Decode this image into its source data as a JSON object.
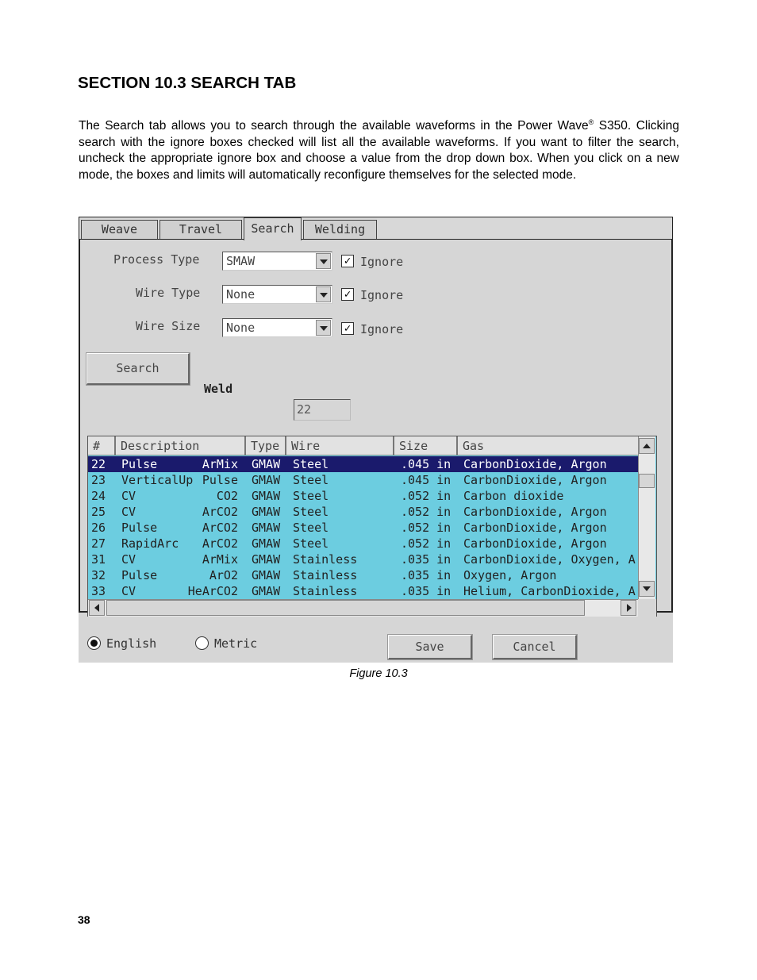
{
  "heading": "SECTION 10.3 SEARCH TAB",
  "paragraph": {
    "part1": "The Search tab allows you to search through the available waveforms in the Power Wave",
    "reg": "®",
    "part2": " S350. Clicking search with the ignore boxes checked will list all the available waveforms. If you want to filter the search, uncheck the appropriate ignore box and choose a value from the drop down box. When you click on a new mode, the boxes and limits will automatically reconfigure themselves for the selected mode."
  },
  "ui": {
    "tabs": [
      "Weave",
      "Travel",
      "Search",
      "Welding"
    ],
    "active_tab": "Search",
    "fields": [
      {
        "label": "Process Type",
        "value": "SMAW",
        "ignore_label": "Ignore",
        "ignore_checked": true
      },
      {
        "label": "Wire Type",
        "value": "None",
        "ignore_label": "Ignore",
        "ignore_checked": true
      },
      {
        "label": "Wire Size",
        "value": "None",
        "ignore_label": "Ignore",
        "ignore_checked": true
      }
    ],
    "check_glyph": "✓",
    "search_button": "Search",
    "weld_label": "Weld",
    "weld_value": "22",
    "table": {
      "headers": [
        "#",
        "Description",
        "Type",
        "Wire",
        "Size",
        "Gas"
      ],
      "selected_row_color": "#1a1a6c",
      "rows_color": "#6ccde0",
      "rows": [
        {
          "num": "22",
          "desc": "Pulse",
          "sub": "ArMix",
          "type": "GMAW",
          "wire": "Steel",
          "size": ".045 in",
          "gas": "CarbonDioxide, Argon",
          "selected": true
        },
        {
          "num": "23",
          "desc": "VerticalUp",
          "sub": "Pulse",
          "type": "GMAW",
          "wire": "Steel",
          "size": ".045 in",
          "gas": "CarbonDioxide, Argon"
        },
        {
          "num": "24",
          "desc": "CV",
          "sub": "CO2",
          "type": "GMAW",
          "wire": "Steel",
          "size": ".052 in",
          "gas": "Carbon dioxide"
        },
        {
          "num": "25",
          "desc": "CV",
          "sub": "ArCO2",
          "type": "GMAW",
          "wire": "Steel",
          "size": ".052 in",
          "gas": "CarbonDioxide, Argon"
        },
        {
          "num": "26",
          "desc": "Pulse",
          "sub": "ArCO2",
          "type": "GMAW",
          "wire": "Steel",
          "size": ".052 in",
          "gas": "CarbonDioxide, Argon"
        },
        {
          "num": "27",
          "desc": "RapidArc",
          "sub": "ArCO2",
          "type": "GMAW",
          "wire": "Steel",
          "size": ".052 in",
          "gas": "CarbonDioxide, Argon"
        },
        {
          "num": "31",
          "desc": "CV",
          "sub": "ArMix",
          "type": "GMAW",
          "wire": "Stainless",
          "size": ".035 in",
          "gas": "CarbonDioxide, Oxygen, A"
        },
        {
          "num": "32",
          "desc": "Pulse",
          "sub": "ArO2",
          "type": "GMAW",
          "wire": "Stainless",
          "size": ".035 in",
          "gas": "Oxygen, Argon"
        },
        {
          "num": "33",
          "desc": "CV",
          "sub": "HeArCO2",
          "type": "GMAW",
          "wire": "Stainless",
          "size": ".035 in",
          "gas": "Helium, CarbonDioxide, A"
        }
      ]
    },
    "units": {
      "english": "English",
      "metric": "Metric",
      "selected": "English"
    },
    "save_button": "Save",
    "cancel_button": "Cancel"
  },
  "caption": "Figure 10.3",
  "page_number": "38"
}
